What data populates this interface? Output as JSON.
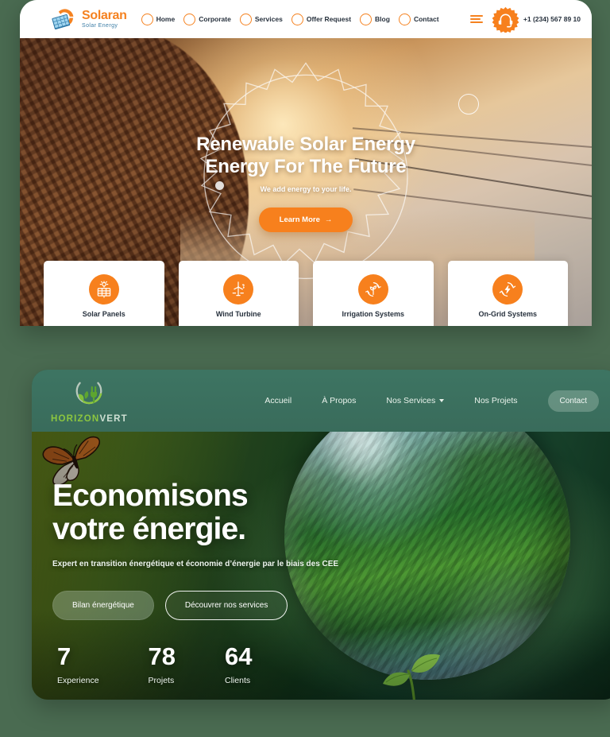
{
  "page": {
    "background_color": "#4a6b51"
  },
  "mockup_solaran": {
    "logo": {
      "brand": "Solaran",
      "tagline": "Solar Energy",
      "brand_color": "#f58220",
      "tagline_color": "#3a7ca5",
      "icon": "solar-panel-sun-logo"
    },
    "nav": [
      {
        "label": "Home"
      },
      {
        "label": "Corporate"
      },
      {
        "label": "Services"
      },
      {
        "label": "Offer Request"
      },
      {
        "label": "Blog"
      },
      {
        "label": "Contact"
      }
    ],
    "menu_icon": "hamburger-icon",
    "support": {
      "icon": "headset-support-icon",
      "phone": "+1 (234) 567 89 10"
    },
    "hero": {
      "title_line1": "Renewable Solar Energy",
      "title_line2": "Energy For The Future",
      "subtitle": "We add energy to your life.",
      "cta_label": "Learn More",
      "cta_arrow": "→",
      "cta_color": "#f7801d",
      "image_description": "person-at-laptop-sunset-photo",
      "decoration": "sun-rays-outline-overlay"
    },
    "cards": [
      {
        "label": "Solar Panels",
        "icon": "solar-panel-icon"
      },
      {
        "label": "Wind Turbine",
        "icon": "wind-turbine-icon"
      },
      {
        "label": "Irrigation Systems",
        "icon": "plant-recycle-icon"
      },
      {
        "label": "On-Grid Systems",
        "icon": "lightning-recycle-icon"
      }
    ]
  },
  "mockup_horizonvert": {
    "logo": {
      "word_a": "HORIZON",
      "word_b": "VERT",
      "icon": "leaf-plug-circle-logo",
      "color_a": "#8cc63f",
      "color_b": "#cfe0d4"
    },
    "nav": [
      {
        "label": "Accueil",
        "has_dropdown": false
      },
      {
        "label": "À Propos",
        "has_dropdown": false
      },
      {
        "label": "Nos Services",
        "has_dropdown": true
      },
      {
        "label": "Nos Projets",
        "has_dropdown": false
      }
    ],
    "contact_label": "Contact",
    "hero": {
      "title_line1": "Economisons",
      "title_line2": "votre énergie.",
      "subtitle": "Expert en transition énergétique et économie d’énergie par le biais des CEE",
      "buttons": [
        {
          "label": "Bilan énergétique",
          "style": "filled"
        },
        {
          "label": "Découvrer nos services",
          "style": "outline"
        }
      ],
      "image_description": "glass-sphere-forest-reflection-photo",
      "decorations": [
        "monarch-butterfly",
        "green-sprout"
      ]
    },
    "stats": [
      {
        "value": "7",
        "label": "Experience"
      },
      {
        "value": "78",
        "label": "Projets"
      },
      {
        "value": "64",
        "label": "Clients"
      }
    ]
  }
}
